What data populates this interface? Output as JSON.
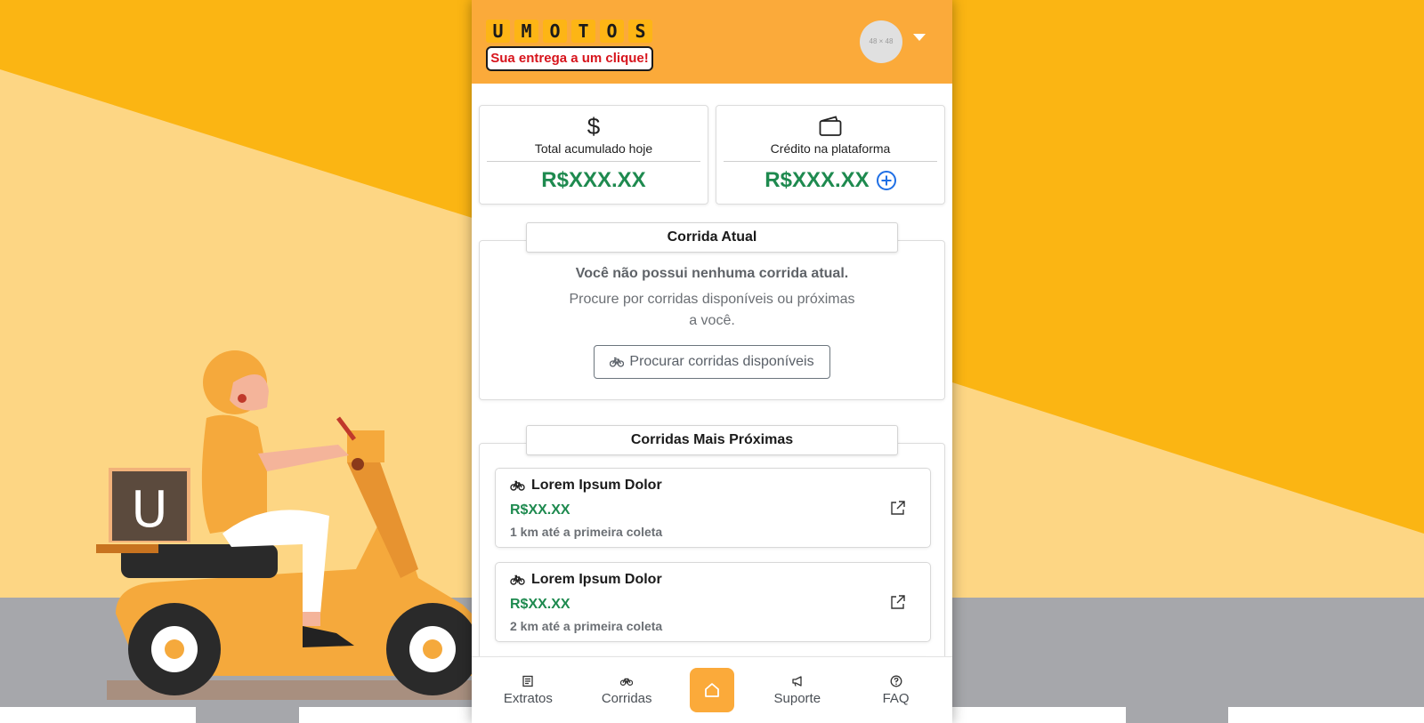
{
  "header": {
    "logo_letters": [
      "U",
      "M",
      "O",
      "T",
      "O",
      "S"
    ],
    "logo_tagline": "Sua entrega a um clique!",
    "avatar_placeholder": "48 × 48",
    "menu_caret_icon": "caret-down-icon"
  },
  "stats": {
    "today_icon": "dollar-icon",
    "today_symbol": "$",
    "today_label": "Total acumulado hoje",
    "today_value": "R$XXX.XX",
    "credit_icon": "wallet-icon",
    "credit_label": "Crédito na plataforma",
    "credit_value": "R$XXX.XX",
    "add_credit_icon": "plus-circle-icon"
  },
  "current_ride": {
    "title": "Corrida Atual",
    "empty_title": "Você não possui nenhuma corrida atual.",
    "empty_text": "Procure por corridas disponíveis ou próximas a você.",
    "search_button": "Procurar corridas disponíveis",
    "search_icon": "bicycle-icon"
  },
  "nearby": {
    "title": "Corridas Mais Próximas",
    "rides": [
      {
        "name": "Lorem Ipsum Dolor",
        "price": "R$XX.XX",
        "distance": "1 km até a primeira coleta"
      },
      {
        "name": "Lorem Ipsum Dolor",
        "price": "R$XX.XX",
        "distance": "2 km até a primeira coleta"
      }
    ]
  },
  "bottom_nav": {
    "extratos": "Extratos",
    "corridas": "Corridas",
    "home_icon": "home-icon",
    "suporte": "Suporte",
    "faq": "FAQ"
  },
  "colors": {
    "brand_orange": "#fbaa3a",
    "brand_yellow": "#fdb515",
    "money_green": "#1e8a4f",
    "accent_blue": "#1f6fe5"
  }
}
